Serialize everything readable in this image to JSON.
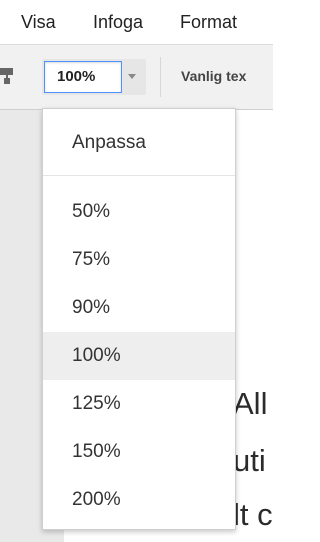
{
  "menubar": {
    "items": [
      "Visa",
      "Infoga",
      "Format"
    ]
  },
  "toolbar": {
    "zoom_value": "100%",
    "style_label": "Vanlig tex"
  },
  "zoom_menu": {
    "fit_label": "Anpassa",
    "options": [
      "50%",
      "75%",
      "90%",
      "100%",
      "125%",
      "150%",
      "200%"
    ],
    "selected": "100%"
  },
  "document": {
    "lines": [
      "All",
      "uti",
      "lt c"
    ]
  }
}
